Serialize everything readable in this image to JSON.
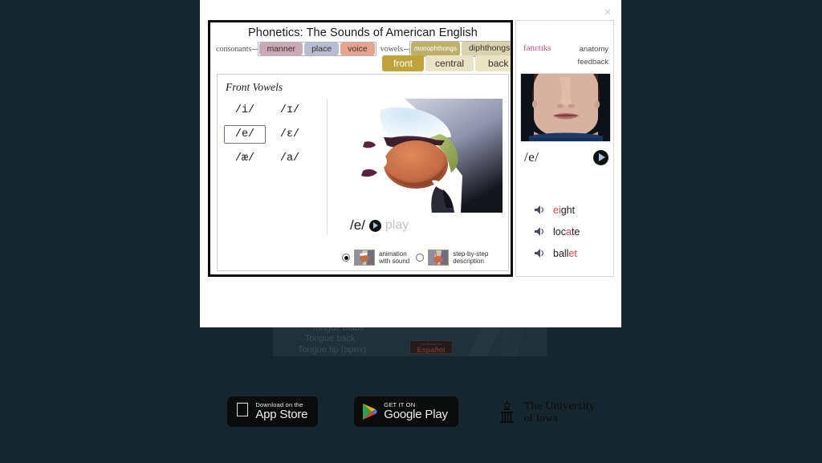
{
  "background": {
    "anatomy_labels": [
      "Tongue blade",
      "Tongue back",
      "Tongue tip (apex)"
    ],
    "espanol_small": "Contenido en",
    "espanol_label": "Español",
    "badges": [
      {
        "name": "app-store",
        "small": "Download on the",
        "big": "App Store"
      },
      {
        "name": "google-play",
        "small": "GET IT ON",
        "big": "Google Play"
      }
    ],
    "university": {
      "line1": "The University",
      "line2": "of Iowa"
    },
    "page_bg": "#16262e"
  },
  "modal": {
    "close_label": "×",
    "close_icon": "close-icon"
  },
  "app": {
    "title": "Phonetics:  The Sounds of American English",
    "nav": {
      "consonants_label": "consonants",
      "vowels_label": "vowels",
      "consonant_tabs": [
        {
          "label": "manner",
          "color": "#c9a9b4",
          "selected": false
        },
        {
          "label": "place",
          "color": "#b7bcd2",
          "selected": false
        },
        {
          "label": "voice",
          "color": "#e6a48c",
          "selected": false
        }
      ],
      "vowel_tabs": [
        {
          "label": "monophthongs",
          "color": "#bdb06a",
          "selected": true
        },
        {
          "label": "diphthongs",
          "color": "#d9d3ad",
          "selected": false
        }
      ],
      "position_tabs": [
        {
          "label": "front",
          "color": "#c0a33c",
          "selected": true
        },
        {
          "label": "central",
          "color": "#eae3c4",
          "selected": false
        },
        {
          "label": "back",
          "color": "#eae3c4",
          "selected": false
        }
      ]
    },
    "panel": {
      "title": "Front Vowels",
      "vowels": [
        {
          "symbol": "/i/",
          "selected": false
        },
        {
          "symbol": "/ɪ/",
          "selected": false
        },
        {
          "symbol": "/e/",
          "selected": true
        },
        {
          "symbol": "/ɛ/",
          "selected": false
        },
        {
          "symbol": "/æ/",
          "selected": false
        },
        {
          "symbol": "/a/",
          "selected": false
        }
      ],
      "stage_icon": "sagittal-mouth-diagram",
      "play_ipa": "/e/",
      "play_label": "play",
      "play_icon": "play-icon"
    },
    "view_options": [
      {
        "label_line1": "animation",
        "label_line2": "with sound",
        "selected": true,
        "icon": "mouth-animation-thumbnail"
      },
      {
        "label_line1": "step-by-step",
        "label_line2": "description",
        "selected": false,
        "icon": "mouth-steps-thumbnail"
      }
    ]
  },
  "sidebar": {
    "brand": "fənɛtɪks",
    "brand_color": "#b1537b",
    "links": [
      "anatomy",
      "feedback"
    ],
    "video_icon": "face-video-still",
    "ipa": "/e/",
    "play_icon": "play-icon",
    "words": [
      {
        "pre": "",
        "hl": "ei",
        "post": "ght",
        "speaker_icon": "speaker-icon"
      },
      {
        "pre": "loc",
        "hl": "a",
        "post": "te",
        "speaker_icon": "speaker-icon"
      },
      {
        "pre": "ball",
        "hl": "et",
        "post": "",
        "speaker_icon": "speaker-icon"
      }
    ],
    "highlight_color": "#e24141"
  }
}
